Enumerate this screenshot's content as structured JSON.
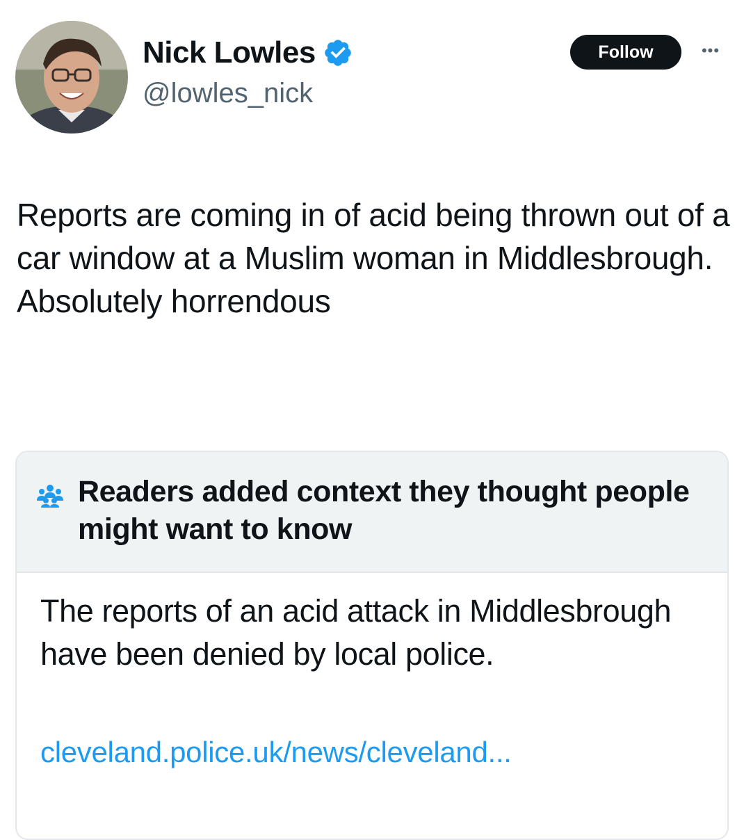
{
  "author": {
    "name": "Nick Lowles",
    "handle": "@lowles_nick",
    "verified": true,
    "avatar_icon": "profile-photo"
  },
  "actions": {
    "follow_label": "Follow",
    "more_icon": "ellipsis-icon",
    "more_glyph": "•••"
  },
  "tweet": {
    "text": "Reports are coming in of acid being thrown out of a car window at a Muslim woman in Middlesbrough. Absolutely horrendous"
  },
  "community_note": {
    "icon": "people-icon",
    "title": "Readers added context they thought people might want to know",
    "body": "The reports of an acid attack in Middlesbrough have been denied by local police.",
    "link_text": "cleveland.police.uk/news/cleveland..."
  },
  "colors": {
    "text": "#0f1419",
    "secondary": "#536471",
    "link": "#1d9bf0",
    "verified": "#1d9bf0",
    "note_header_bg": "#eff3f4"
  }
}
